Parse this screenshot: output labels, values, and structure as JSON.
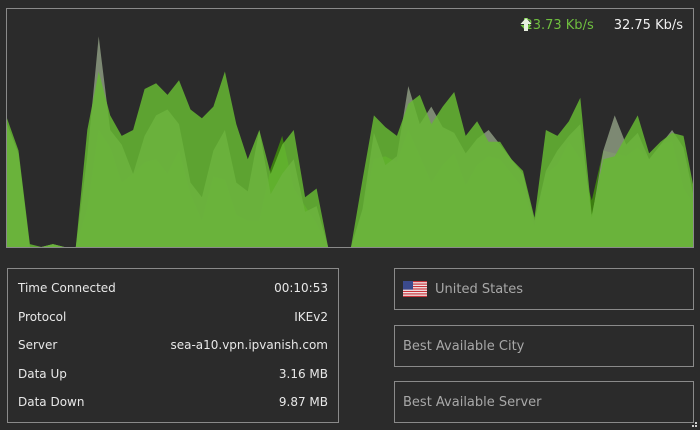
{
  "speeds": {
    "download": "23.73 Kb/s",
    "upload": "32.75 Kb/s"
  },
  "chart_data": {
    "type": "area",
    "series": [
      {
        "values": [
          40,
          31,
          0,
          0,
          1,
          0,
          0,
          13,
          40,
          34,
          22,
          25,
          29,
          30,
          25,
          33,
          18,
          9,
          24,
          23,
          11,
          9,
          9,
          27,
          38,
          20,
          14,
          8,
          0,
          0,
          0,
          12,
          30,
          31,
          29,
          40,
          31,
          22,
          28,
          32,
          21,
          28,
          31,
          30,
          25,
          20,
          7,
          25,
          28,
          36,
          30,
          16,
          33,
          32,
          31,
          34,
          30,
          35,
          36,
          20,
          14
        ]
      },
      {
        "values": [
          42,
          32,
          0,
          0,
          1,
          0,
          0,
          31,
          72,
          40,
          35,
          25,
          38,
          45,
          47,
          42,
          22,
          17,
          33,
          40,
          22,
          19,
          40,
          18,
          25,
          30,
          12,
          14,
          0,
          0,
          0,
          13,
          39,
          28,
          31,
          55,
          42,
          48,
          41,
          39,
          32,
          37,
          40,
          35,
          30,
          25,
          9,
          26,
          33,
          38,
          42,
          10,
          33,
          45,
          35,
          39,
          30,
          35,
          40,
          34,
          15
        ]
      },
      {
        "values": [
          44,
          33,
          1,
          0,
          1,
          0,
          0,
          40,
          60,
          45,
          38,
          40,
          54,
          56,
          52,
          57,
          47,
          44,
          48,
          60,
          42,
          30,
          40,
          25,
          35,
          40,
          17,
          20,
          0,
          0,
          0,
          23,
          45,
          41,
          38,
          49,
          52,
          42,
          48,
          53,
          38,
          43,
          36,
          36,
          30,
          26,
          10,
          40,
          38,
          43,
          51,
          11,
          30,
          31,
          38,
          45,
          32,
          36,
          39,
          38,
          18
        ]
      }
    ]
  },
  "colors": {
    "dark_green": "#3c7d10",
    "light_gray": "#8c9a80",
    "bright_green": "#66b832"
  },
  "stats": {
    "rows": [
      {
        "label": "Time Connected",
        "value": "00:10:53"
      },
      {
        "label": "Protocol",
        "value": "IKEv2"
      },
      {
        "label": "Server",
        "value": "sea-a10.vpn.ipvanish.com"
      },
      {
        "label": "Data Up",
        "value": "3.16 MB"
      },
      {
        "label": "Data Down",
        "value": "9.87 MB"
      }
    ]
  },
  "selectors": {
    "country": "United States",
    "city": "Best Available City",
    "server": "Best Available Server"
  },
  "icons": [
    "download-arrow-icon",
    "upload-arrow-icon",
    "us-flag-icon",
    "resize-grip-icon"
  ]
}
